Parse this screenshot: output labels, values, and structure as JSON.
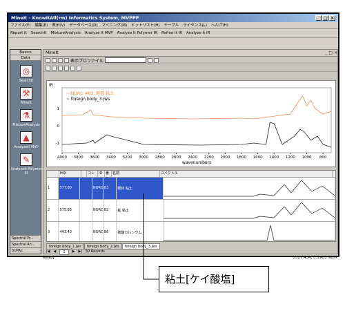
{
  "window": {
    "title": "MineIt - KnowItAll(rm) Informatics System, MVPPP"
  },
  "menu": [
    "ファイル(F)",
    "編集(E)",
    "表示(V)",
    "データベース(D)",
    "マイニング(M)",
    "ヒットリスト(H)",
    "テーブル",
    "ライセンス(L)",
    "ヘルプ(H)"
  ],
  "toolbar": [
    "Report It",
    "SearchIt",
    "MixtureAnalysis",
    "Analyze It MVP",
    "Analyze It Polymer IR",
    "Refine It IR",
    "Analyze It IR"
  ],
  "sidebar": {
    "tab1": "Basics",
    "tab2": "Data",
    "items": [
      "SearchIt",
      "MineIt",
      "MixtureAnalysis",
      "AnalyzeIt MVP",
      "AnalyzeIt Polymer IR"
    ],
    "bottom": [
      "Spectral Pr...",
      "Spectral An...",
      "3UPAC"
    ]
  },
  "mdi": {
    "title": "MineIt",
    "display_label": "表示プロファイル",
    "spectrum_label": "IR"
  },
  "spectrum": {
    "legend1": "~INORG #83: 軽目  粘土",
    "legend2": "~ foreign body_3.jws",
    "xlabel": "wavenumbers",
    "xticks": [
      4000,
      3800,
      3600,
      3400,
      3200,
      3000,
      2800,
      2600,
      2400,
      2200,
      2000,
      1800,
      1600,
      1400,
      1200,
      1000,
      800
    ],
    "yticks": [
      "1",
      "0",
      "-1"
    ]
  },
  "table": {
    "headers": [
      "",
      "HQI",
      "",
      "コレ",
      "ID",
      "番号",
      "名前",
      "スペクトル"
    ],
    "rows": [
      {
        "n": "1",
        "hqi": "577.80",
        "col": "NORG",
        "id": "83",
        "name": "軽目  粘土"
      },
      {
        "n": "2",
        "hqi": "575.83",
        "col": "NORC",
        "id": "82",
        "name": "鉱  粘土"
      },
      {
        "n": "3",
        "hqi": "443.43",
        "col": "NORC",
        "id": "86",
        "name": "硫酸カルシウム"
      }
    ]
  },
  "file_tabs": [
    "foreign body_1.jws",
    "foreign body_2.jws",
    "foreign body_3.jws"
  ],
  "nav": {
    "page": "1",
    "records": "50 Records"
  },
  "status": {
    "left": "Ready",
    "coords": "0527.434, 0.5903",
    "mode": "NUM"
  },
  "callout": {
    "text": "粘土[ケイ酸塩]"
  },
  "colors": {
    "query_trace": "#f08a4b",
    "match_trace": "#222222",
    "selected": "#2f57c9"
  },
  "chart_data": {
    "type": "line",
    "series": [
      {
        "name": "~INORG #83: 軽目  粘土"
      },
      {
        "name": "~ foreign body_3.jws"
      }
    ],
    "xlabel": "wavenumbers",
    "xlim": [
      4000,
      700
    ]
  }
}
